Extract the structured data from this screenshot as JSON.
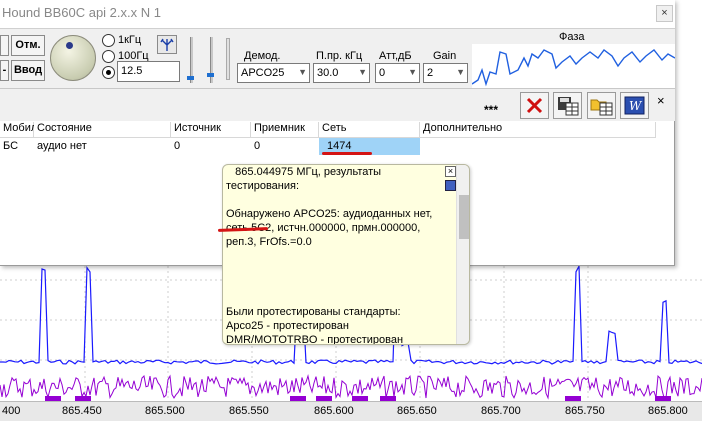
{
  "window": {
    "title": "Hound BB60C api 2.x.x N 1",
    "close_glyph": "×"
  },
  "controls": {
    "btn_otm": "Отм.",
    "btn_vvod": "Ввод",
    "btn_left_top": "",
    "btn_left_bottom": "-",
    "step_options": [
      "1кГц",
      "100Гц"
    ],
    "step_value": "12.5",
    "demod_label": "Демод.",
    "demod_value": "APCO25",
    "filter_label": "П.пр. кГц",
    "filter_value": "30.0",
    "att_label": "Атт,дБ",
    "att_value": "0",
    "gain_label": "Gain",
    "gain_value": "2",
    "phase_label": "Фаза"
  },
  "toolbar": {
    "status_stars": "***",
    "close_glyph": "×",
    "buttons": [
      "delete-icon",
      "save-table-icon",
      "folder-table-icon",
      "word-export-icon"
    ]
  },
  "grid": {
    "columns": [
      "Мобил",
      "Состояние",
      "Источник",
      "Приемник",
      "Сеть",
      "Дополнительно"
    ],
    "rows": [
      [
        "БС",
        "аудио нет",
        "0",
        "0",
        "1474",
        ""
      ]
    ],
    "selected_cell": "Сеть"
  },
  "popup": {
    "text": "   865.044975 МГц, результаты\nтестирования:\n\nОбнаружено APCO25: аудиоданных нет,\nсеть 5C2, истчн.000000, прмн.000000,\nреп.3, FrOfs.=0.0\n\n\n\n\nБыли протестированы стандарты:\nApco25 - протестирован\nDMR/MOTOTRBO - протестирован\nTETRA - протестирован",
    "close_glyph": "×"
  },
  "spectrum": {
    "freq_labels": [
      "400",
      "865.450",
      "865.500",
      "865.550",
      "865.600",
      "865.650",
      "865.700",
      "865.750",
      "865.800"
    ],
    "trace_color": "#1a1aff",
    "noise_color": "#9400d3",
    "grid_color": "#cfcfcf"
  },
  "colors": {
    "selection": "#9fd3f7",
    "annotation_red": "#d41414",
    "tooltip_bg": "#ffffe0"
  }
}
